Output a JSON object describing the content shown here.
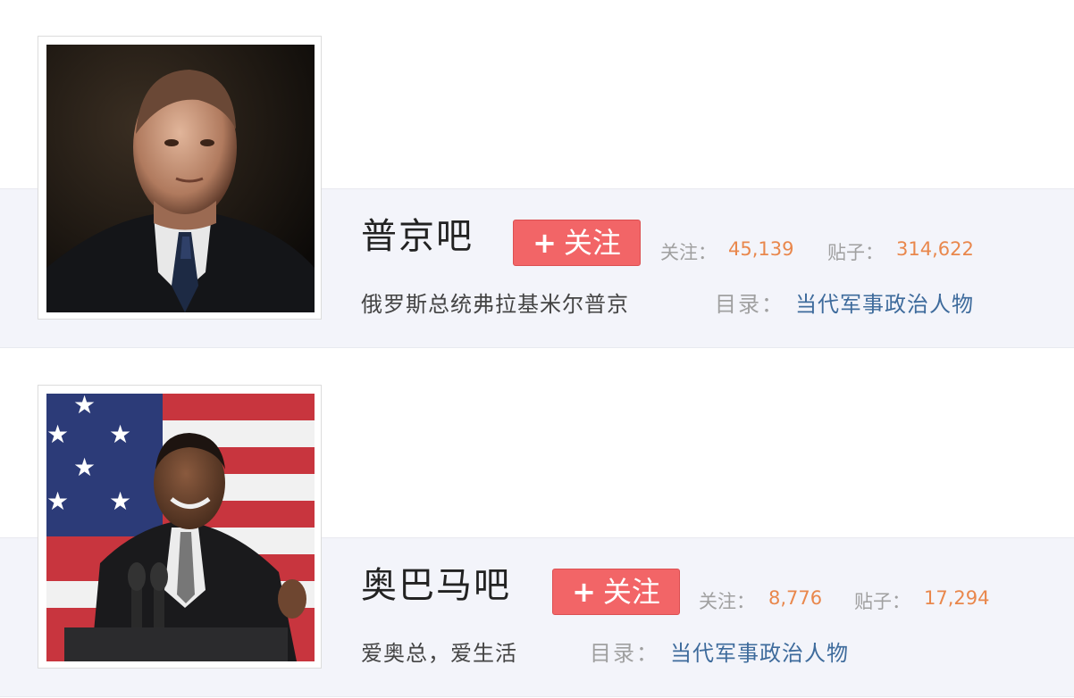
{
  "forums": [
    {
      "name": "普京吧",
      "follow_label": "关注",
      "follow_icon": "plus-icon",
      "followers_label": "关注：",
      "followers_count": "45,139",
      "posts_label": "贴子：",
      "posts_count": "314,622",
      "description": "俄罗斯总统弗拉基米尔普京",
      "category_label": "目录：",
      "category": "当代军事政治人物"
    },
    {
      "name": "奥巴马吧",
      "follow_label": "关注",
      "follow_icon": "plus-icon",
      "followers_label": "关注：",
      "followers_count": "8,776",
      "posts_label": "贴子：",
      "posts_count": "17,294",
      "description": "爱奥总，爱生活",
      "category_label": "目录：",
      "category": "当代军事政治人物"
    }
  ],
  "colors": {
    "follow_button": "#f26567",
    "count": "#e9874c",
    "link": "#3e6b9c",
    "band": "#f3f4fa"
  }
}
